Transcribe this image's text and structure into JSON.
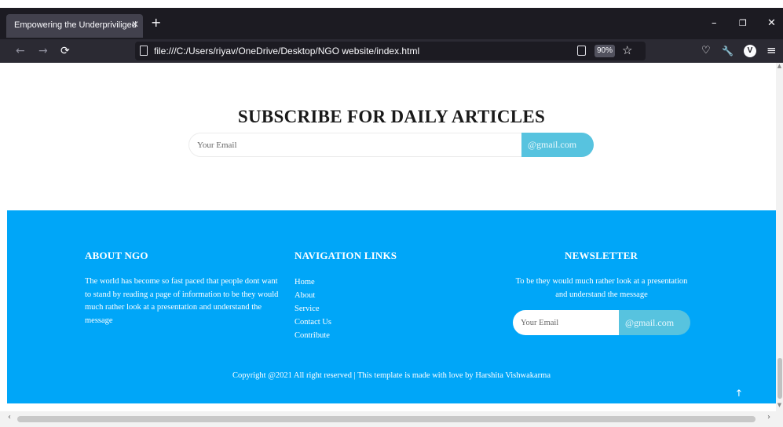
{
  "browser": {
    "tab_title": "Empowering the Underpriviliged",
    "tab_close": "✕",
    "new_tab": "+",
    "url": "file:///C:/Users/riyav/OneDrive/Desktop/NGO website/index.html",
    "zoom": "90%",
    "icons": {
      "back": "←",
      "forward": "→",
      "reload": "⟳",
      "bookmark": "☆",
      "pocket": "♡",
      "tools": "🔧",
      "profile": "V",
      "menu": "≡",
      "minimize": "–",
      "restore": "❐",
      "close": "✕"
    },
    "colors": {
      "titlebar": "#1c1b22",
      "toolbar": "#2b2a33",
      "tab": "#42414d"
    }
  },
  "page": {
    "subscribe": {
      "title": "SUBSCRIBE FOR DAILY ARTICLES",
      "email_placeholder": "Your Email",
      "button_label": "@gmail.com"
    },
    "footer": {
      "about": {
        "heading": "ABOUT NGO",
        "text": "The world has become so fast paced that people dont want to stand by reading a page of information to be they would much rather look at a presentation and understand the message"
      },
      "navigation": {
        "heading": "NAVIGATION LINKS",
        "links": [
          "Home",
          "About",
          "Service",
          "Contact Us",
          "Contribute"
        ]
      },
      "newsletter": {
        "heading": "NEWSLETTER",
        "text": "To be they would much rather look at a presentation and understand the message",
        "email_placeholder": "Your Email",
        "button_label": "@gmail.com"
      },
      "copyright": "Copyright @2021 All right reserved | This template is made with love by Harshita Vishwakarma",
      "scroll_top_icon": "🡑"
    },
    "colors": {
      "footer_bg": "#00a6f8",
      "button_bg": "#57c3df",
      "heading": "#1a1a1a"
    }
  }
}
